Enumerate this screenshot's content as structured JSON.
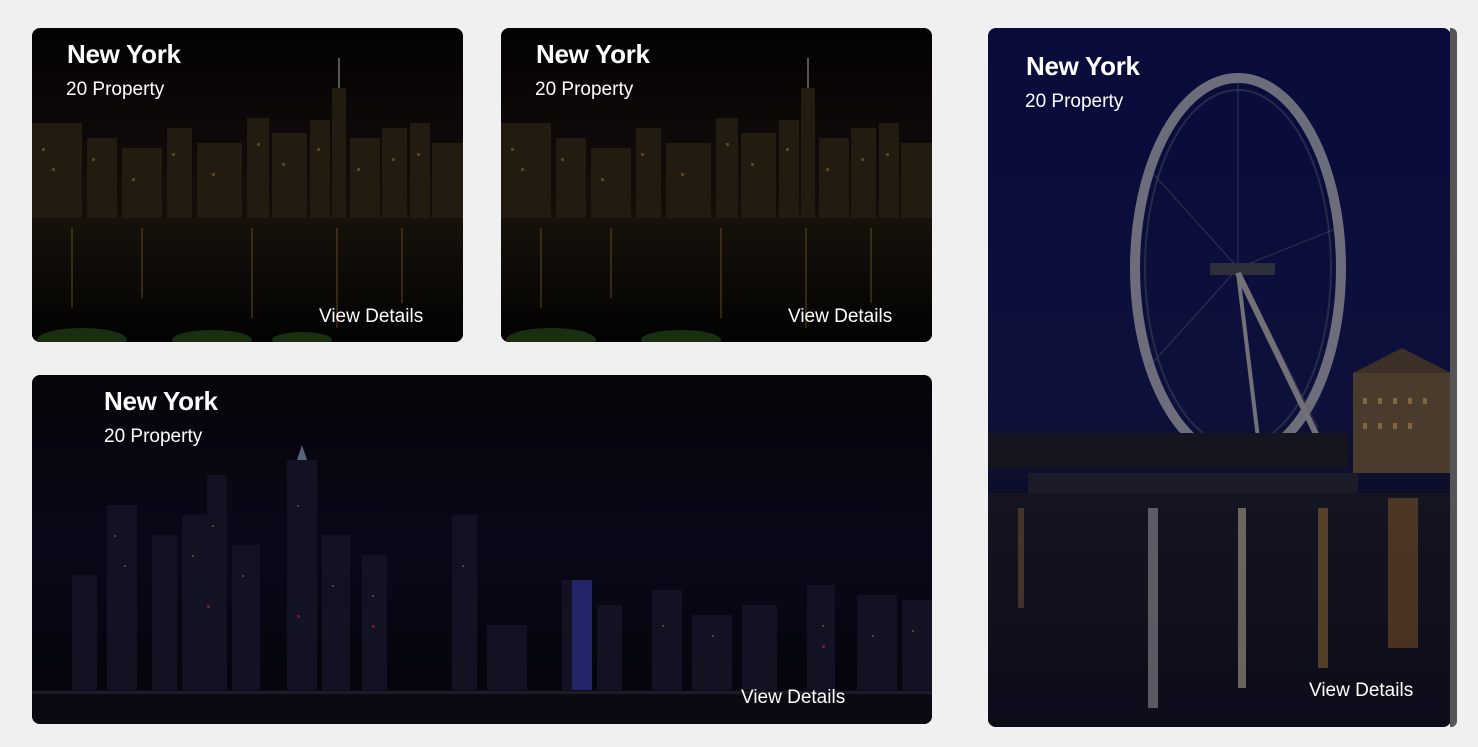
{
  "cards": [
    {
      "city": "New York",
      "count": "20 Property",
      "link": "View Details",
      "scene": "skyline-river"
    },
    {
      "city": "New York",
      "count": "20 Property",
      "link": "View Details",
      "scene": "skyline-river"
    },
    {
      "city": "New York",
      "count": "20 Property",
      "link": "View Details",
      "scene": "skyline-panorama"
    },
    {
      "city": "New York",
      "count": "20 Property",
      "link": "View Details",
      "scene": "ferris-wheel"
    }
  ],
  "colors": {
    "page_bg": "#f0f0f0",
    "text": "#ffffff",
    "night_sky": "#0b0a1e",
    "ferris_sky": "#0d1145"
  }
}
